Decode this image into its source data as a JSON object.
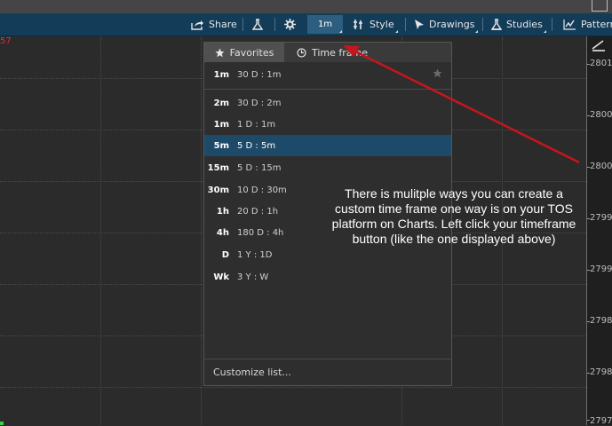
{
  "toolbar": {
    "share_label": "Share",
    "timeframe_label": "1m",
    "style_label": "Style",
    "drawings_label": "Drawings",
    "studies_label": "Studies",
    "patterns_label": "Pattern"
  },
  "chart": {
    "last_price_fragment": "57",
    "price_axis_labels": [
      "2801",
      "2800",
      "2800",
      "2799",
      "2799",
      "2798",
      "2798",
      "2797"
    ]
  },
  "menu": {
    "tabs": [
      {
        "label": "Favorites",
        "icon": "star-icon",
        "active": true
      },
      {
        "label": "Time frame",
        "icon": "clock-icon",
        "active": false
      }
    ],
    "favorites": [
      {
        "code": "1m",
        "label": "30 D : 1m",
        "starred": true
      }
    ],
    "items": [
      {
        "code": "2m",
        "label": "30 D : 2m",
        "selected": false
      },
      {
        "code": "1m",
        "label": "1 D : 1m",
        "selected": false
      },
      {
        "code": "5m",
        "label": "5 D : 5m",
        "selected": true
      },
      {
        "code": "15m",
        "label": "5 D : 15m",
        "selected": false
      },
      {
        "code": "30m",
        "label": "10 D : 30m",
        "selected": false
      },
      {
        "code": "1h",
        "label": "20 D : 1h",
        "selected": false
      },
      {
        "code": "4h",
        "label": "180 D : 4h",
        "selected": false
      },
      {
        "code": "D",
        "label": "1 Y : 1D",
        "selected": false
      },
      {
        "code": "Wk",
        "label": "3 Y : W",
        "selected": false
      }
    ],
    "customize_label": "Customize list..."
  },
  "annotation": {
    "text": "There is mulitple ways you can create a custom time frame one way is on your TOS platform on Charts. Left click your timeframe button (like the one displayed above)",
    "arrow_color": "#c4161c"
  },
  "colors": {
    "toolbar_bg": "#133c59",
    "selected_row": "#1e4a6a",
    "price_red": "#e0303a"
  }
}
